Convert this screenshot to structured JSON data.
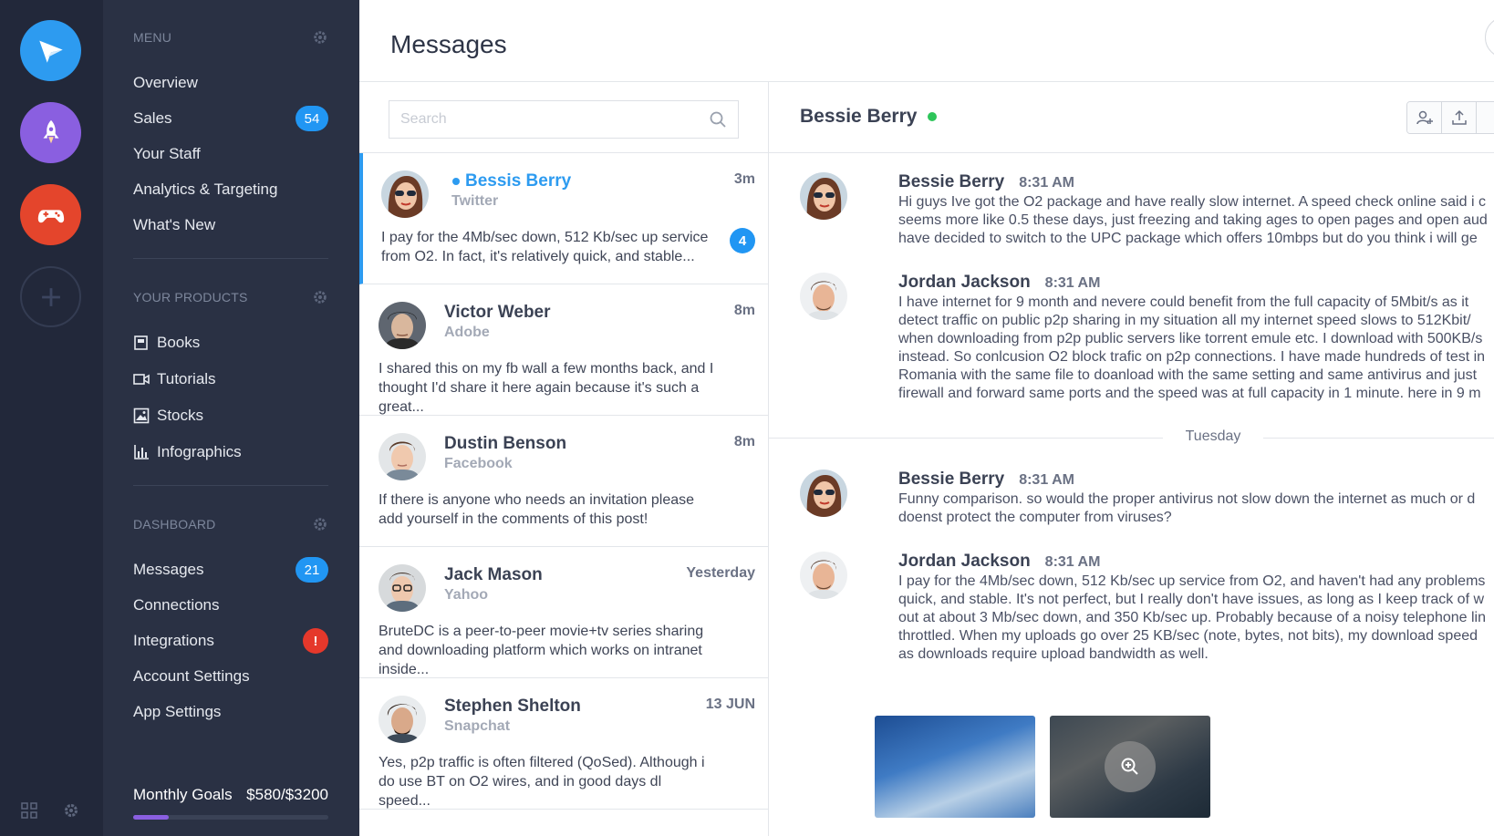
{
  "sidebar": {
    "menu_title": "MENU",
    "menu_items": [
      {
        "label": "Overview"
      },
      {
        "label": "Sales",
        "badge": "54"
      },
      {
        "label": "Your Staff"
      },
      {
        "label": "Analytics & Targeting"
      },
      {
        "label": "What's New"
      }
    ],
    "products_title": "YOUR PRODUCTS",
    "product_items": [
      {
        "label": "Books",
        "icon": "book-icon"
      },
      {
        "label": "Tutorials",
        "icon": "video-icon"
      },
      {
        "label": "Stocks",
        "icon": "image-icon"
      },
      {
        "label": "Infographics",
        "icon": "bar-chart-icon"
      }
    ],
    "dashboard_title": "DASHBOARD",
    "dashboard_items": [
      {
        "label": "Messages",
        "badge": "21"
      },
      {
        "label": "Connections"
      },
      {
        "label": "Integrations",
        "badge": "!"
      },
      {
        "label": "Account Settings"
      },
      {
        "label": "App Settings"
      }
    ],
    "goals_label": "Monthly Goals",
    "goals_value": "$580/$3200",
    "goals_progress": 0.18
  },
  "header": {
    "title": "Messages"
  },
  "search": {
    "placeholder": "Search"
  },
  "conversations": [
    {
      "name": "Bessis Berry",
      "source": "Twitter",
      "time": "3m",
      "snippet": "I pay for the 4Mb/sec down, 512 Kb/sec up service from O2. In fact, it's relatively quick, and stable...",
      "unread": "4"
    },
    {
      "name": "Victor Weber",
      "source": "Adobe",
      "time": "8m",
      "snippet": "I shared this on my fb wall a few months back, and I thought I'd share it here again because it's such a great..."
    },
    {
      "name": "Dustin Benson",
      "source": "Facebook",
      "time": "8m",
      "snippet": "If there is anyone who needs an invitation please add yourself in the comments of this post!"
    },
    {
      "name": "Jack Mason",
      "source": "Yahoo",
      "time": "Yesterday",
      "snippet": "BruteDC is a peer-to-peer movie+tv series sharing and downloading platform which works on intranet inside..."
    },
    {
      "name": "Stephen Shelton",
      "source": "Snapchat",
      "time": "13 JUN",
      "snippet": "Yes, p2p traffic is often filtered (QoSed). Although i do use BT on O2 wires, and in good days dl speed..."
    }
  ],
  "chat": {
    "contact_name": "Bessie Berry",
    "messages": [
      {
        "author": "Bessie Berry",
        "time": "8:31 AM",
        "lines": [
          "Hi guys Ive got the O2 package and have really slow internet. A speed check online said i c",
          "seems more like 0.5 these days, just freezing and taking ages to open pages and open aud",
          "have decided to switch to the UPC package which offers 10mbps but do you think i will ge"
        ]
      },
      {
        "author": "Jordan Jackson",
        "time": "8:31 AM",
        "lines": [
          "I have internet for 9 month and nevere could benefit from the full capacity of 5Mbit/s as it",
          "detect traffic on public p2p sharing in my situation all my internet speed slows to 512Kbit/",
          "when downloading from p2p public servers like torrent emule etc. I download with 500KB/s",
          "instead. So conlcusion O2 block trafic on p2p connections. I have made hundreds of test in",
          "Romania with the same file to doanload with the same setting and same antivirus and just",
          "firewall and forward same ports and the speed was at full capacity in 1 minute. here in 9 m"
        ]
      },
      {
        "author": "Bessie Berry",
        "time": "8:31 AM",
        "lines": [
          "Funny comparison. so would the proper antivirus not slow down the internet as much or d",
          "doenst protect the computer from viruses?"
        ]
      },
      {
        "author": "Jordan Jackson",
        "time": "8:31 AM",
        "lines": [
          "I pay for the 4Mb/sec down, 512 Kb/sec up service from O2, and haven't had any problems",
          "quick, and stable. It's not perfect, but I really don't have issues, as long as I keep track of w",
          "out at about 3 Mb/sec down, and 350 Kb/sec up. Probably because of a noisy telephone lin",
          "throttled. When my uploads go over 25 KB/sec (note, bytes, not bits), my download speed",
          "as downloads require upload bandwidth as well."
        ]
      }
    ],
    "day_separator": "Tuesday"
  },
  "colors": {
    "accent": "#2d9bf0",
    "sidebar": "#2a3144",
    "rail": "#22283a",
    "online": "#2ec55a",
    "alert": "#e5382b"
  }
}
